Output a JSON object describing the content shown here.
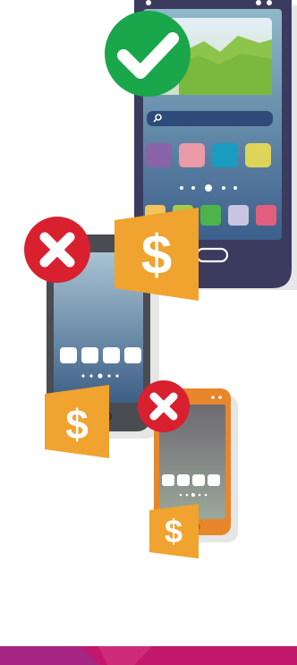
{
  "colors": {
    "background": "#ffffff",
    "bottom_band": "#c2186b",
    "bottom_band_accent": "#9c2a8c",
    "large_phone_body": "#3a3b5e",
    "medium_phone_body": "#4a4c52",
    "small_phone_body": "#e8862b",
    "price_tag": "#f0a32e",
    "approve_badge": "#1aa64b",
    "reject_badge": "#d8202f",
    "app_tiles": [
      "#8a64a8",
      "#e99ba8",
      "#1a9bc0",
      "#ddd55a"
    ],
    "dock_tiles": [
      "#f2c45c",
      "#a9c94a",
      "#4db44b",
      "#c9c4e0",
      "#e25e7f"
    ]
  },
  "items": {
    "large_phone": {
      "badge": "check-icon",
      "price_tag": "$"
    },
    "medium_phone": {
      "badge": "x-icon",
      "price_tag": "$"
    },
    "small_phone": {
      "badge": "x-icon",
      "price_tag": "$"
    }
  }
}
